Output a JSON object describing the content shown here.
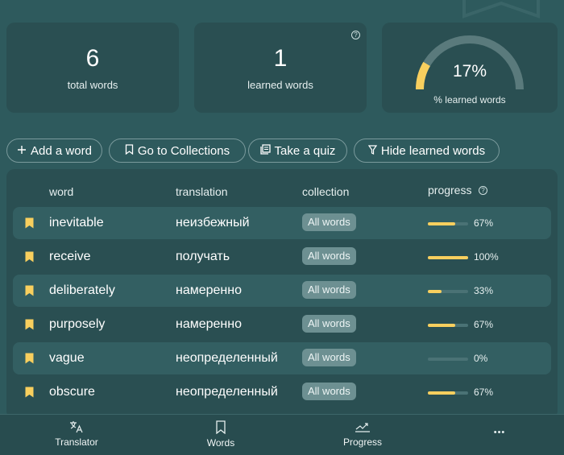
{
  "stats": {
    "total": {
      "value": "6",
      "caption": "total words"
    },
    "learned": {
      "value": "1",
      "caption": "learned words",
      "help_icon": "?"
    },
    "percent": {
      "value": "17%",
      "caption": "% learned words",
      "fraction": 0.17,
      "accent": "#f8cf5e"
    }
  },
  "toolbar": {
    "add": {
      "label": "Add a word",
      "icon": "plus-icon"
    },
    "collections": {
      "label": "Go to Collections",
      "icon": "bookmark-icon"
    },
    "quiz": {
      "label": "Take a quiz",
      "icon": "quiz-icon"
    },
    "hide": {
      "label": "Hide learned words",
      "icon": "filter-icon"
    }
  },
  "table": {
    "headers": {
      "word": "word",
      "translation": "translation",
      "collection": "collection",
      "progress": "progress"
    },
    "rows": [
      {
        "word": "inevitable",
        "translation": "неизбежный",
        "collection": "All words",
        "progress": "67%",
        "fraction": 0.67
      },
      {
        "word": "receive",
        "translation": "получать",
        "collection": "All words",
        "progress": "100%",
        "fraction": 1.0
      },
      {
        "word": "deliberately",
        "translation": "намеренно",
        "collection": "All words",
        "progress": "33%",
        "fraction": 0.33
      },
      {
        "word": "purposely",
        "translation": "намеренно",
        "collection": "All words",
        "progress": "67%",
        "fraction": 0.67
      },
      {
        "word": "vague",
        "translation": "неопределенный",
        "collection": "All words",
        "progress": "0%",
        "fraction": 0.0
      },
      {
        "word": "obscure",
        "translation": "неопределенный",
        "collection": "All words",
        "progress": "67%",
        "fraction": 0.67
      }
    ]
  },
  "nav": {
    "translator": "Translator",
    "words": "Words",
    "progress": "Progress",
    "more": "•••"
  },
  "colors": {
    "bookmark": "#f8cf5e",
    "accent": "#f8cf5e"
  }
}
